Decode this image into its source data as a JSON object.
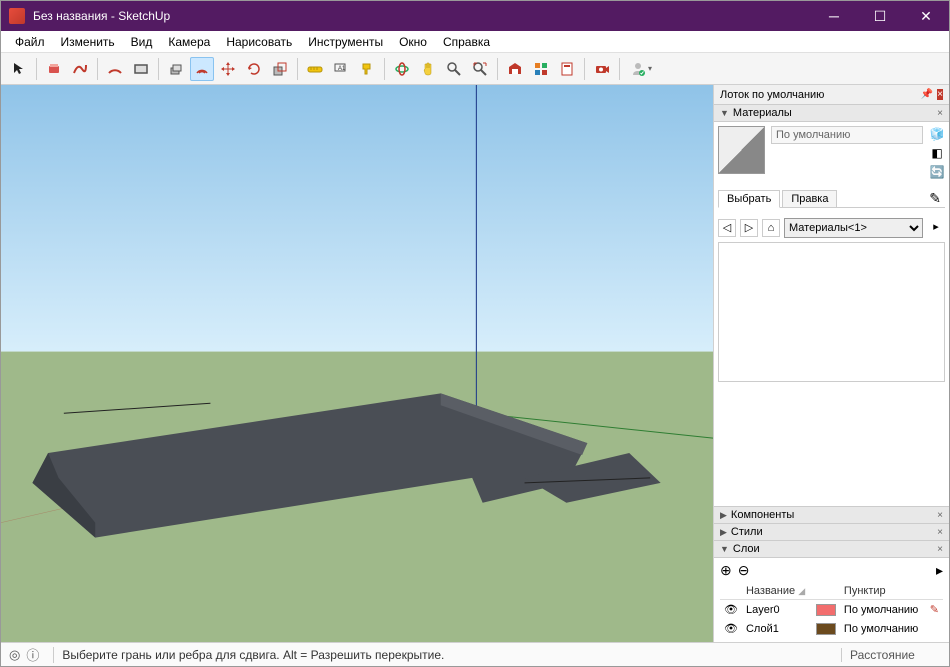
{
  "titlebar": {
    "title": "Без названия - SketchUp"
  },
  "menu": {
    "file": "Файл",
    "edit": "Изменить",
    "view": "Вид",
    "camera": "Камера",
    "draw": "Нарисовать",
    "tools": "Инструменты",
    "window": "Окно",
    "help": "Справка"
  },
  "tools": {
    "select": "↖",
    "eraser": "📕",
    "line": "〰",
    "arc": "⌒",
    "rect": "▭",
    "circle": "⭕",
    "pushpull": "⬚",
    "offset": "◫",
    "move": "✥",
    "rotate": "⟳",
    "scale": "⤡",
    "tape": "📏",
    "text": "A",
    "paint": "🪣",
    "orbit": "🔄",
    "pan": "✋",
    "zoom": "🔍",
    "zoomext": "🔎",
    "3dw": "🌐",
    "ext": "🧩",
    "layout": "📄",
    "advcam": "📷",
    "user": "👤"
  },
  "tray": {
    "title": "Лоток по умолчанию",
    "materials": {
      "header": "Материалы",
      "default_name": "По умолчанию",
      "tab_select": "Выбрать",
      "tab_edit": "Правка",
      "dropdown": "Материалы<1>"
    },
    "components": {
      "header": "Компоненты"
    },
    "styles": {
      "header": "Стили"
    },
    "layers": {
      "header": "Слои",
      "col_name": "Название",
      "col_dash": "Пунктир",
      "rows": [
        {
          "visible": "👁",
          "name": "Layer0",
          "color": "#f26d6d",
          "dash": "По умолчанию",
          "edit": "✎"
        },
        {
          "visible": "👁",
          "name": "Слой1",
          "color": "#6b4a1e",
          "dash": "По умолчанию",
          "edit": ""
        }
      ]
    }
  },
  "status": {
    "hint": "Выберите грань или ребра для сдвига. Alt = Разрешить перекрытие.",
    "dist_label": "Расстояние"
  }
}
